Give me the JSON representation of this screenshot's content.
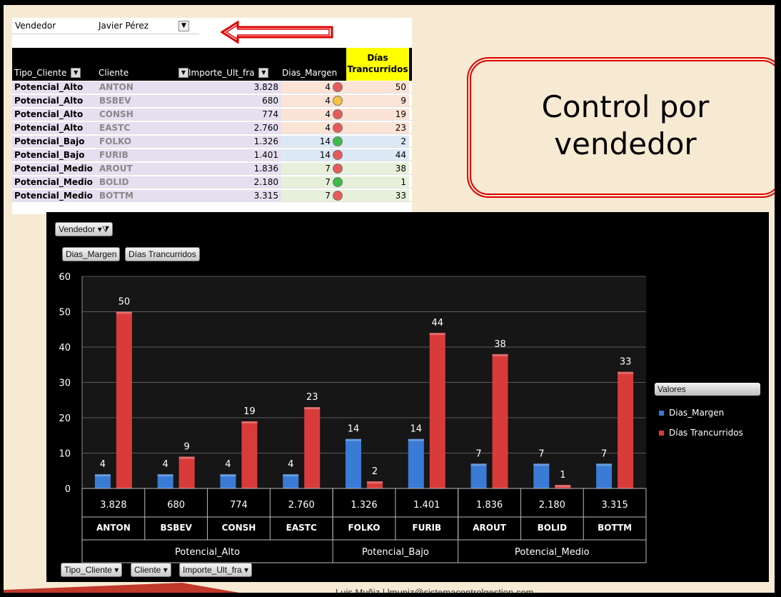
{
  "pivot_table": {
    "filter_label": "Vendedor",
    "filter_value": "Javier Pérez",
    "headers": {
      "tipo_cliente": "Tipo_Cliente",
      "cliente": "Cliente",
      "importe": "Importe_Ult_fra",
      "dias_margen": "Dias_Margen",
      "dias_tr_line1": "Días",
      "dias_tr_line2": "Trancurridos"
    },
    "rows": [
      {
        "tipo": "Potencial_Alto",
        "cliente": "ANTON",
        "importe": "3.828",
        "margen": "4",
        "status": "red",
        "dias": "50"
      },
      {
        "tipo": "Potencial_Alto",
        "cliente": "BSBEV",
        "importe": "680",
        "margen": "4",
        "status": "yellow",
        "dias": "9"
      },
      {
        "tipo": "Potencial_Alto",
        "cliente": "CONSH",
        "importe": "774",
        "margen": "4",
        "status": "red",
        "dias": "19"
      },
      {
        "tipo": "Potencial_Alto",
        "cliente": "EASTC",
        "importe": "2.760",
        "margen": "4",
        "status": "red",
        "dias": "23"
      },
      {
        "tipo": "Potencial_Bajo",
        "cliente": "FOLKO",
        "importe": "1.326",
        "margen": "14",
        "status": "green",
        "dias": "2"
      },
      {
        "tipo": "Potencial_Bajo",
        "cliente": "FURIB",
        "importe": "1.401",
        "margen": "14",
        "status": "red",
        "dias": "44"
      },
      {
        "tipo": "Potencial_Medio",
        "cliente": "AROUT",
        "importe": "1.836",
        "margen": "7",
        "status": "red",
        "dias": "38"
      },
      {
        "tipo": "Potencial_Medio",
        "cliente": "BOLID",
        "importe": "2.180",
        "margen": "7",
        "status": "green",
        "dias": "1"
      },
      {
        "tipo": "Potencial_Medio",
        "cliente": "BOTTM",
        "importe": "3.315",
        "margen": "7",
        "status": "red",
        "dias": "33"
      }
    ],
    "status_colors": {
      "red": "#e85a5a",
      "yellow": "#f5c242",
      "green": "#3dbb4a"
    },
    "margin_colors": {
      "Potencial_Alto": "#fbe3d6",
      "Potencial_Bajo": "#dde8f5",
      "Potencial_Medio": "#e7f0da"
    }
  },
  "title_box": {
    "line1": "Control por",
    "line2": "vendedor"
  },
  "chart_controls": {
    "filter_button": "Vendedor",
    "value_button_1": "Dias_Margen",
    "value_button_2": "Días Trancurridos",
    "axis_button_1": "Tipo_Cliente",
    "axis_button_2": "Cliente",
    "axis_button_3": "Importe_Ult_fra",
    "legend_title": "Valores"
  },
  "chart_data": {
    "type": "bar",
    "ylim": [
      0,
      60
    ],
    "yticks": [
      0,
      10,
      20,
      30,
      40,
      50,
      60
    ],
    "grid": true,
    "legend": "right",
    "categories": [
      "ANTON",
      "BSBEV",
      "CONSH",
      "EASTC",
      "FOLKO",
      "FURIB",
      "AROUT",
      "BOLID",
      "BOTTM"
    ],
    "importes": [
      "3.828",
      "680",
      "774",
      "2.760",
      "1.326",
      "1.401",
      "1.836",
      "2.180",
      "3.315"
    ],
    "groups": [
      {
        "name": "Potencial_Alto",
        "count": 4
      },
      {
        "name": "Potencial_Bajo",
        "count": 2
      },
      {
        "name": "Potencial_Medio",
        "count": 3
      }
    ],
    "series": [
      {
        "name": "Dias_Margen",
        "color": "#3a7bd5",
        "values": [
          4,
          4,
          4,
          4,
          14,
          14,
          7,
          7,
          7
        ]
      },
      {
        "name": "Días Trancurridos",
        "color": "#d93b3b",
        "values": [
          50,
          9,
          19,
          23,
          2,
          44,
          38,
          1,
          33
        ]
      }
    ]
  },
  "footer": "Luis Muñiz | lmuniz@sistemacontrolgestion.com"
}
